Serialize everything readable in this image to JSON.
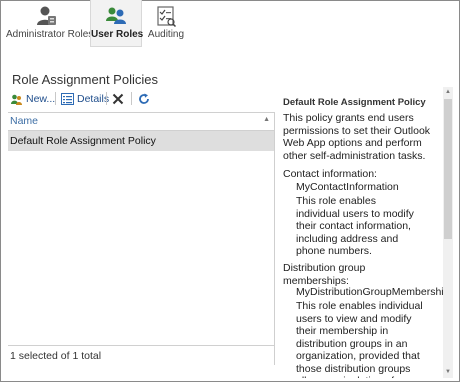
{
  "ribbon": {
    "tabs": [
      {
        "label": "Administrator Roles",
        "icon": "admin-user-icon",
        "active": false
      },
      {
        "label": "User Roles",
        "icon": "users-icon",
        "active": true
      },
      {
        "label": "Auditing",
        "icon": "audit-checklist-icon",
        "active": false
      }
    ]
  },
  "section": {
    "title": "Role Assignment Policies"
  },
  "toolbar": {
    "new_label": "New...",
    "details_label": "Details",
    "delete_icon": "delete-x-icon",
    "refresh_icon": "refresh-icon"
  },
  "list": {
    "column_name": "Name",
    "rows": [
      "Default Role Assignment Policy"
    ],
    "status": "1 selected of 1 total"
  },
  "details": {
    "title": "Default Role Assignment Policy",
    "description": "This policy grants end users permissions to set their Outlook Web App options and perform other self-administration tasks.",
    "sections": [
      {
        "heading": "Contact information:",
        "role": "MyContactInformation",
        "role_desc": "This role enables individual users to modify their contact information, including address and phone numbers."
      },
      {
        "heading": "Distribution group memberships:",
        "role": "MyDistributionGroupMembership",
        "role_desc": "This role enables individual users to view and modify their membership in distribution groups in an organization, provided that those distribution groups allow manipulation of"
      }
    ]
  },
  "colors": {
    "accent": "#1f4e8c",
    "selected_row": "#dedede",
    "header_text": "#3d6ea5"
  }
}
